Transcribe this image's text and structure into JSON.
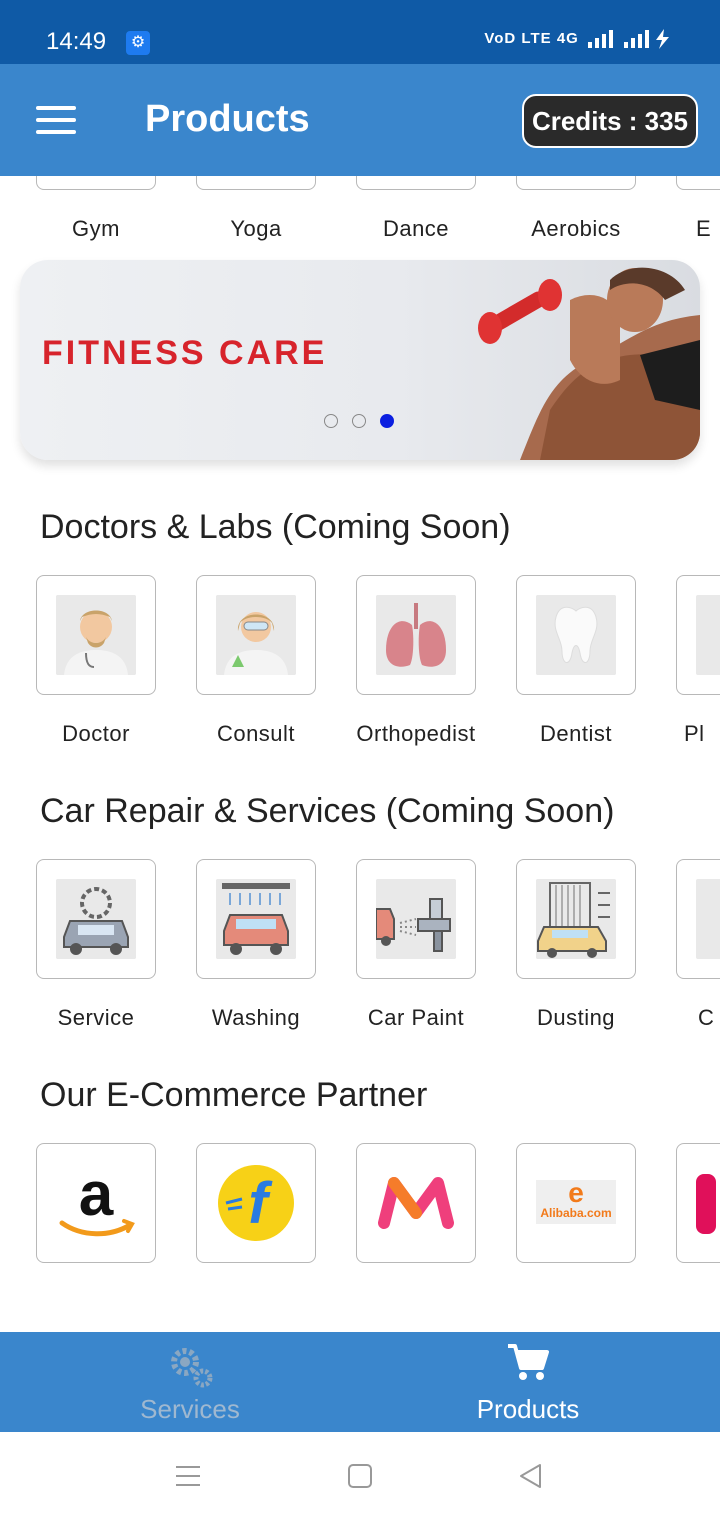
{
  "status_bar": {
    "time": "14:49",
    "network": "VoD LTE 4G"
  },
  "app_bar": {
    "title": "Products",
    "credits": "Credits : 335"
  },
  "fitness_row": {
    "items": [
      "Gym",
      "Yoga",
      "Dance",
      "Aerobics",
      "E"
    ]
  },
  "banner": {
    "text": "FITNESS CARE",
    "active_dot": 3,
    "dot_count": 3
  },
  "doctors": {
    "title": "Doctors & Labs (Coming Soon)",
    "items": [
      {
        "label": "Doctor",
        "icon": "doctor-icon"
      },
      {
        "label": "Consult",
        "icon": "lab-scientist-icon"
      },
      {
        "label": "Orthopedist",
        "icon": "lungs-icon"
      },
      {
        "label": "Dentist",
        "icon": "tooth-icon"
      },
      {
        "label": "Pl",
        "icon": "partial-icon"
      }
    ]
  },
  "car": {
    "title": "Car Repair & Services (Coming Soon)",
    "items": [
      {
        "label": "Service",
        "icon": "car-service-icon"
      },
      {
        "label": "Washing",
        "icon": "car-wash-icon"
      },
      {
        "label": "Car Paint",
        "icon": "spray-gun-icon"
      },
      {
        "label": "Dusting",
        "icon": "car-dusting-icon"
      },
      {
        "label": "C",
        "icon": "partial-icon"
      }
    ]
  },
  "ecommerce": {
    "title": "Our E-Commerce Partner",
    "items": [
      {
        "name": "amazon",
        "icon": "amazon-logo"
      },
      {
        "name": "flipkart",
        "icon": "flipkart-logo"
      },
      {
        "name": "myntra",
        "icon": "myntra-logo"
      },
      {
        "name": "Alibaba.com",
        "icon": "alibaba-logo"
      },
      {
        "name": "",
        "icon": "partial-logo"
      }
    ]
  },
  "bottom_nav": {
    "services_label": "Services",
    "products_label": "Products",
    "active": "Products"
  },
  "colors": {
    "primary": "#3a86cc",
    "status": "#0f5aa6",
    "banner_text": "#d7242c",
    "dot_active": "#0b1fe0"
  }
}
